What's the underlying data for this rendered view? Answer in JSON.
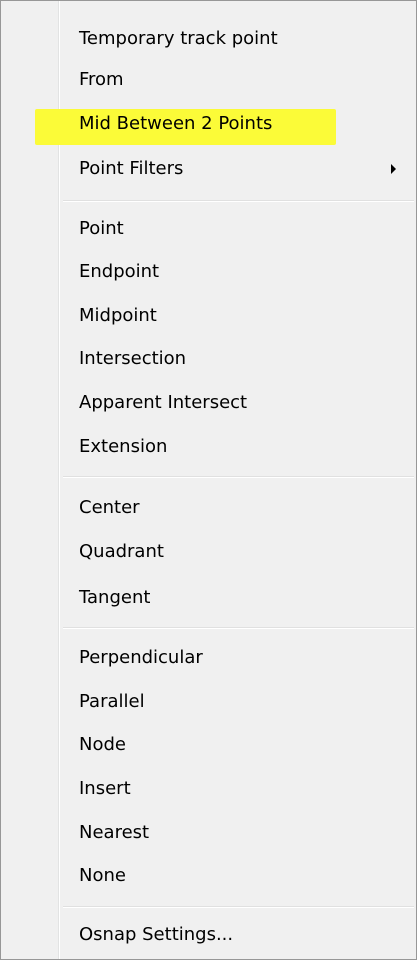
{
  "menu": {
    "groups": [
      {
        "items": [
          {
            "label": "Temporary track point"
          },
          {
            "label": "From"
          },
          {
            "label": "Mid Between 2 Points",
            "highlighted": true
          },
          {
            "label": "Point Filters",
            "submenu": true
          }
        ]
      },
      {
        "items": [
          {
            "label": "Point"
          },
          {
            "label": "Endpoint"
          },
          {
            "label": "Midpoint"
          },
          {
            "label": "Intersection"
          },
          {
            "label": "Apparent Intersect"
          },
          {
            "label": "Extension"
          }
        ]
      },
      {
        "items": [
          {
            "label": "Center"
          },
          {
            "label": "Quadrant"
          },
          {
            "label": "Tangent"
          }
        ]
      },
      {
        "items": [
          {
            "label": "Perpendicular"
          },
          {
            "label": "Parallel"
          },
          {
            "label": "Node"
          },
          {
            "label": "Insert"
          },
          {
            "label": "Nearest"
          },
          {
            "label": "None"
          }
        ]
      },
      {
        "items": [
          {
            "label": "Osnap Settings..."
          }
        ]
      }
    ],
    "highlight_color": "#fbfb38",
    "submenu_icon": "chevron-right-icon"
  }
}
